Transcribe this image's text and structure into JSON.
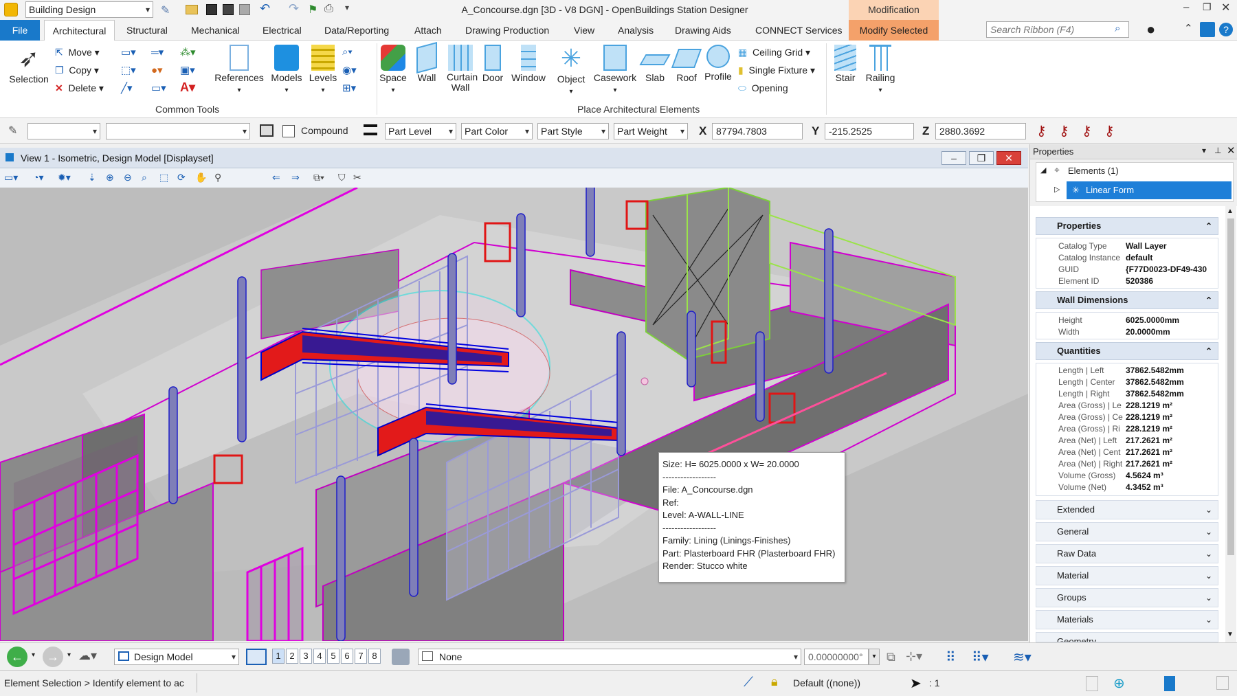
{
  "title_bar": {
    "workspace": "Building Design",
    "title": "A_Concourse.dgn [3D - V8 DGN] - OpenBuildings Station Designer",
    "contextual_group": "Modification",
    "search_placeholder": "Search Ribbon (F4)"
  },
  "tabs": [
    "File",
    "Architectural",
    "Structural",
    "Mechanical",
    "Electrical",
    "Data/Reporting",
    "Attach",
    "Drawing Production",
    "View",
    "Analysis",
    "Drawing Aids",
    "CONNECT Services",
    "Modify Selected"
  ],
  "ribbon": {
    "selection": "Selection",
    "move": "Move",
    "copy": "Copy",
    "delete": "Delete",
    "references": "References",
    "models": "Models",
    "levels": "Levels",
    "common_tools": "Common Tools",
    "space": "Space",
    "wall": "Wall",
    "curtain_wall": "Curtain Wall",
    "door": "Door",
    "window": "Window",
    "object": "Object",
    "casework": "Casework",
    "slab": "Slab",
    "roof": "Roof",
    "profile": "Profile",
    "ceiling_grid": "Ceiling Grid",
    "single_fixture": "Single Fixture",
    "opening": "Opening",
    "place_arch": "Place Architectural Elements",
    "stair": "Stair",
    "railing": "Railing"
  },
  "attributes": {
    "compound": "Compound",
    "part_level": "Part Level",
    "part_color": "Part Color",
    "part_style": "Part Style",
    "part_weight": "Part Weight",
    "x_label": "X",
    "x": "87794.7803",
    "y_label": "Y",
    "y": "-215.2525",
    "z_label": "Z",
    "z": "2880.3692"
  },
  "view": {
    "title": "View 1 - Isometric, Design Model [Displayset]"
  },
  "tooltip": {
    "size": "Size: H= 6025.0000 x W= 20.0000",
    "sep1": "------------------",
    "file": "File: A_Concourse.dgn",
    "ref": "Ref:",
    "level": "Level: A-WALL-LINE",
    "sep2": "------------------",
    "family": "Family: Lining (Linings-Finishes)",
    "part": "Part: Plasterboard FHR (Plasterboard FHR)",
    "render": "Render: Stucco white"
  },
  "properties": {
    "panel_title": "Properties",
    "elements": "Elements (1)",
    "selected": "Linear Form",
    "sections": {
      "properties": "Properties",
      "wall_dimensions": "Wall Dimensions",
      "quantities": "Quantities",
      "collapsed": [
        "Extended",
        "General",
        "Raw Data",
        "Material",
        "Groups",
        "Materials",
        "Geometry"
      ]
    },
    "props": [
      {
        "k": "Catalog Type",
        "v": "Wall Layer"
      },
      {
        "k": "Catalog Instance",
        "v": "default"
      },
      {
        "k": "GUID",
        "v": "{F77D0023-DF49-430"
      },
      {
        "k": "Element ID",
        "v": "520386"
      }
    ],
    "dims": [
      {
        "k": "Height",
        "v": "6025.0000mm"
      },
      {
        "k": "Width",
        "v": "20.0000mm"
      }
    ],
    "quantities": [
      {
        "k": "Length | Left",
        "v": "37862.5482mm"
      },
      {
        "k": "Length | Center",
        "v": "37862.5482mm"
      },
      {
        "k": "Length | Right",
        "v": "37862.5482mm"
      },
      {
        "k": "Area (Gross) | Le",
        "v": "228.1219 m²"
      },
      {
        "k": "Area (Gross) | Ce",
        "v": "228.1219 m²"
      },
      {
        "k": "Area (Gross) | Ri",
        "v": "228.1219 m²"
      },
      {
        "k": "Area (Net) | Left",
        "v": "217.2621 m²"
      },
      {
        "k": "Area (Net) | Cent",
        "v": "217.2621 m²"
      },
      {
        "k": "Area (Net) | Right",
        "v": "217.2621 m²"
      },
      {
        "k": "Volume (Gross)",
        "v": "4.5624 m³"
      },
      {
        "k": "Volume (Net)",
        "v": "4.3452 m³"
      }
    ]
  },
  "bottom": {
    "model": "Design Model",
    "views": [
      "1",
      "2",
      "3",
      "4",
      "5",
      "6",
      "7",
      "8"
    ],
    "display_style": "None",
    "angle": "0.00000000°"
  },
  "status": {
    "prompt": "Element Selection > Identify element to ac",
    "level": "Default ((none))",
    "count": ": 1"
  },
  "colors": {
    "accent_blue": "#1979ca",
    "modify_orange": "#f4a16a",
    "selection_blue": "#1e7fd8"
  }
}
